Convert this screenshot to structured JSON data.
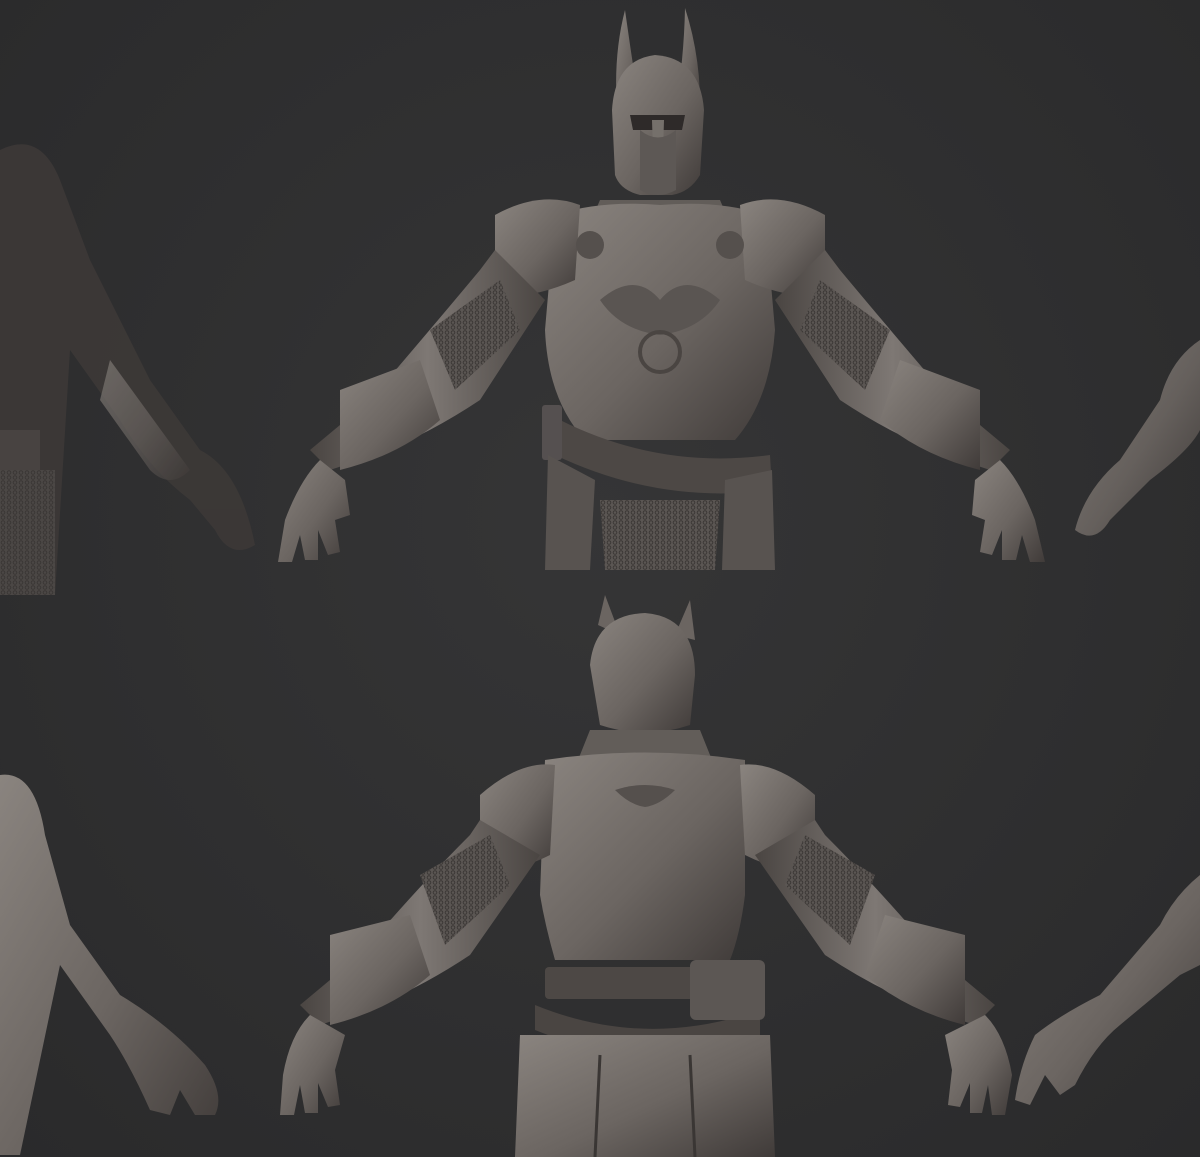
{
  "image": {
    "description_colors": {
      "background": "#2e2e2f",
      "clay": "#6f6a66",
      "clay_dark": "#3f3b39",
      "clay_light": "#8d8782"
    },
    "panels": [
      {
        "view": "front",
        "icon": "armored-warrior-front-icon"
      },
      {
        "view": "back",
        "icon": "armored-warrior-back-icon"
      }
    ]
  }
}
